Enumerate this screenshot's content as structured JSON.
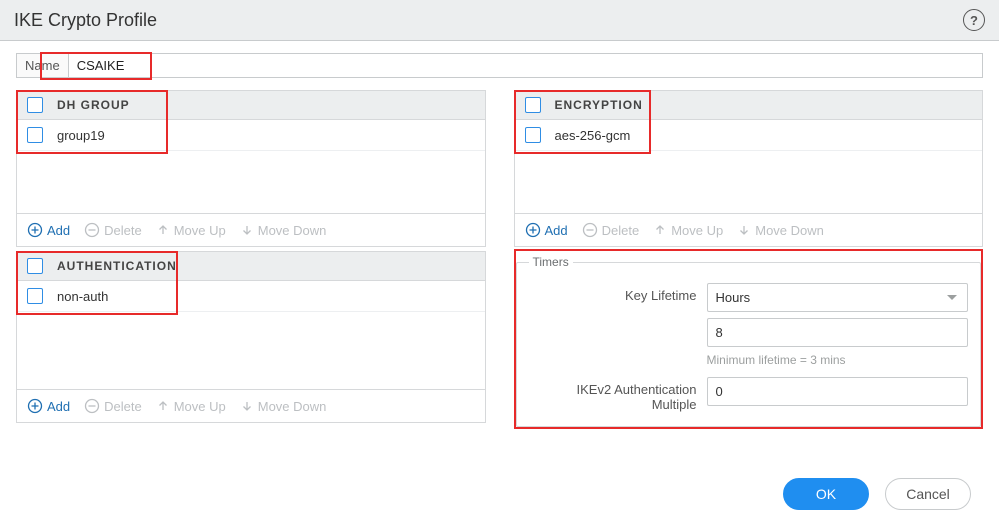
{
  "title": "IKE Crypto Profile",
  "help_label": "?",
  "name_field": {
    "label": "Name",
    "value": "CSAIKE"
  },
  "toolbar": {
    "add": "Add",
    "delete": "Delete",
    "move_up": "Move Up",
    "move_down": "Move Down"
  },
  "panels": {
    "dh_group": {
      "header": "DH GROUP",
      "rows": [
        {
          "label": "group19"
        }
      ]
    },
    "encryption": {
      "header": "ENCRYPTION",
      "rows": [
        {
          "label": "aes-256-gcm"
        }
      ]
    },
    "authentication": {
      "header": "AUTHENTICATION",
      "rows": [
        {
          "label": "non-auth"
        }
      ]
    }
  },
  "timers": {
    "legend": "Timers",
    "key_lifetime": {
      "label": "Key Lifetime",
      "unit": "Hours",
      "value": "8",
      "hint": "Minimum lifetime = 3 mins"
    },
    "ikev2_auth_multiple": {
      "label": "IKEv2 Authentication Multiple",
      "value": "0"
    }
  },
  "actions": {
    "ok": "OK",
    "cancel": "Cancel"
  }
}
